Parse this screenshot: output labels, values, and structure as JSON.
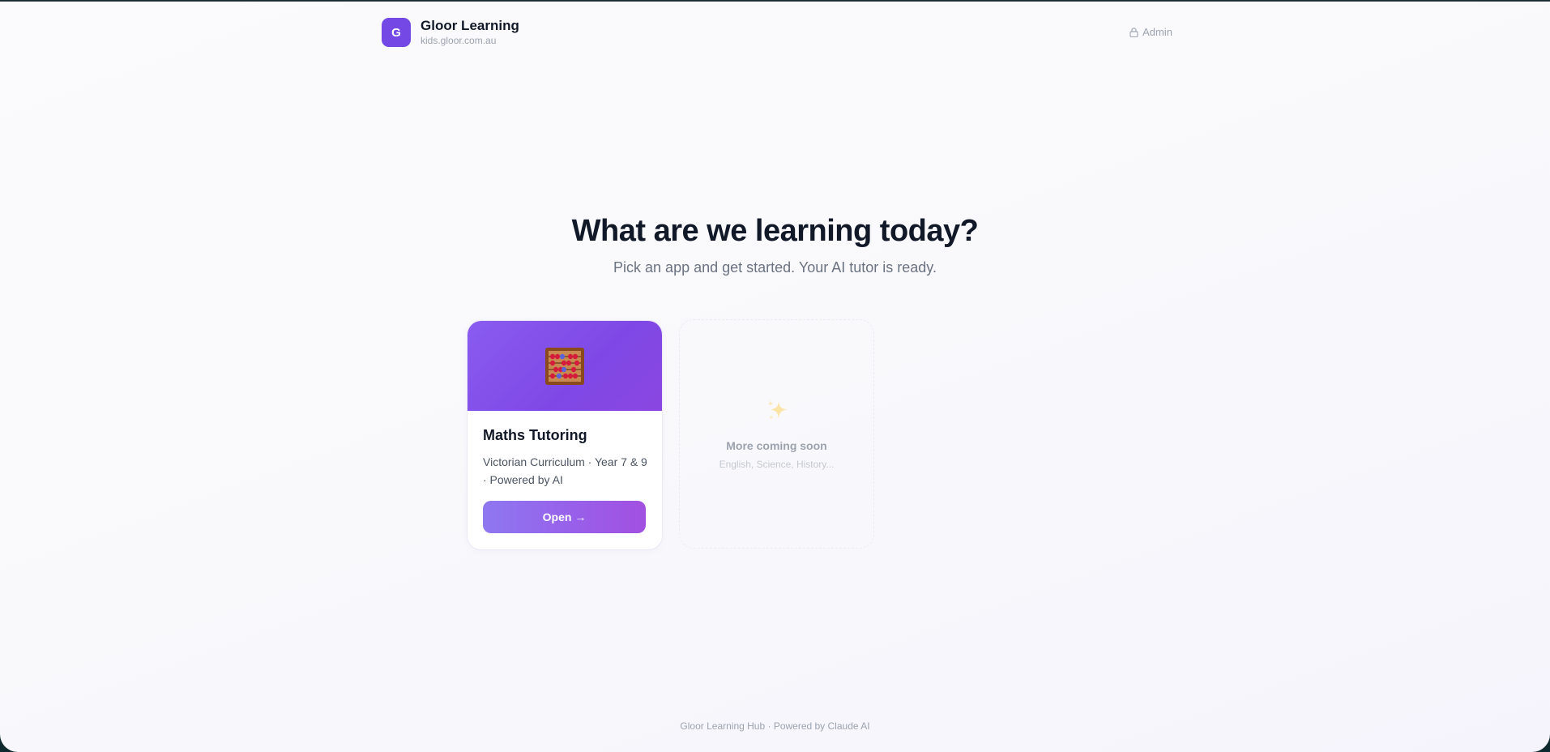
{
  "brand": {
    "logo_letter": "G",
    "title": "Gloor Learning",
    "subtitle": "kids.gloor.com.au"
  },
  "header": {
    "admin_label": "Admin",
    "admin_icon": "lock-icon"
  },
  "hero": {
    "title": "What are we learning today?",
    "subtitle": "Pick an app and get started. Your AI tutor is ready."
  },
  "apps": [
    {
      "icon": "abacus-icon",
      "title": "Maths Tutoring",
      "description": "Victorian Curriculum · Year 7 & 9 · Powered by AI",
      "button_label": "Open →"
    }
  ],
  "coming_soon": {
    "icon": "sparkle-icon",
    "title": "More coming soon",
    "subtitle": "English, Science, History..."
  },
  "footer": {
    "text": "Gloor Learning Hub · Powered by Claude AI"
  },
  "colors": {
    "accent": "#7448e4",
    "banner": "#8a5cf0",
    "text_dark": "#111827",
    "text_muted": "#9ca3af"
  }
}
